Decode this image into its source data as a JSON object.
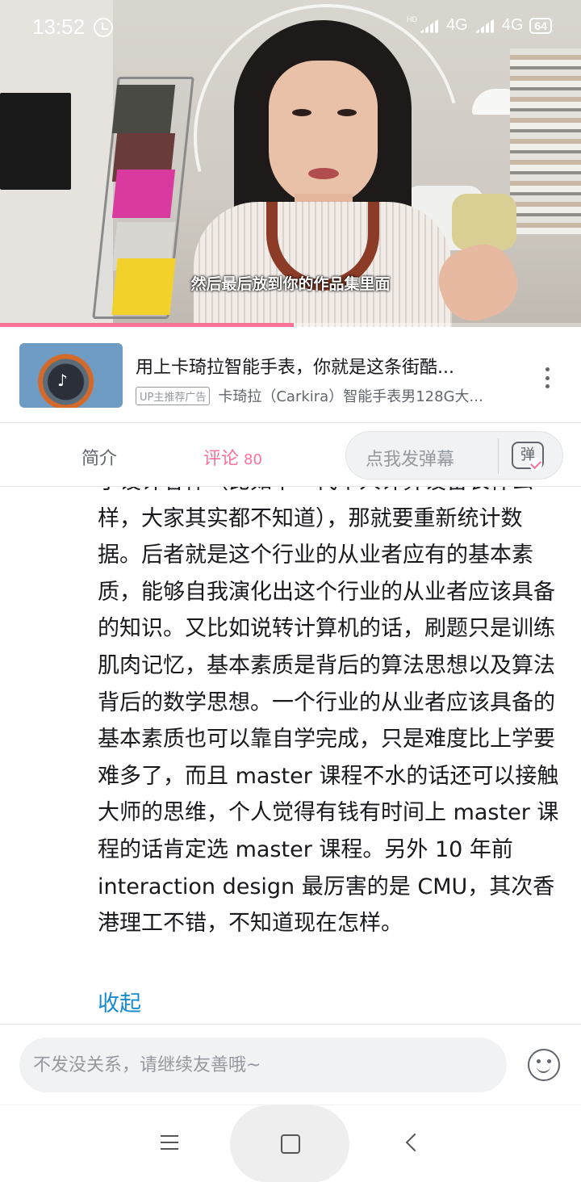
{
  "status_bar": {
    "time": "13:52",
    "network_1": "4G",
    "network_2": "4G",
    "hd_label": "HD",
    "battery": "64"
  },
  "video": {
    "subtitle": "然后最后放到你的作品集里面",
    "progress": 0.505
  },
  "ad": {
    "title": "用上卡琦拉智能手表，你就是这条街酷...",
    "badge": "UP主推荐广告",
    "description": "卡琦拉（Carkira）智能手表男128G大..."
  },
  "tabs": {
    "intro_label": "简介",
    "comments_label": "评论",
    "comments_count": "80"
  },
  "danmaku": {
    "placeholder": "点我发弹幕",
    "button_label": "弹"
  },
  "comment": {
    "text": "了设计客体（比如下一代个人计算设备长什么样，大家其实都不知道），那就要重新统计数据。后者就是这个行业的从业者应有的基本素质，能够自我演化出这个行业的从业者应该具备的知识。又比如说转计算机的话，刷题只是训练肌肉记忆，基本素质是背后的算法思想以及算法背后的数学思想。一个行业的从业者应该具备的基本素质也可以靠自学完成，只是难度比上学要难多了，而且 master 课程不水的话还可以接触大师的思维，个人觉得有钱有时间上 master 课程的话肯定选 master 课程。另外 10 年前 interaction design 最厉害的是 CMU，其次香港理工不错，不知道现在怎样。",
    "collapse_label": "收起"
  },
  "reply": {
    "placeholder": "不发没关系，请继续友善哦~"
  },
  "colors": {
    "accent": "#fb7299",
    "link": "#178bcf",
    "text_primary": "#18191c",
    "text_secondary": "#61666d",
    "text_muted": "#9499a0"
  }
}
